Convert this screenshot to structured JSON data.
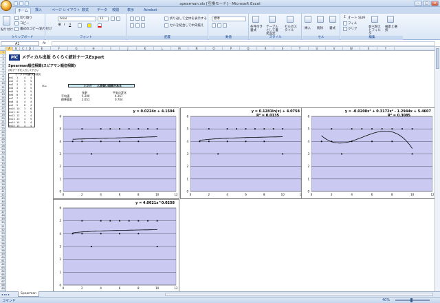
{
  "window": {
    "title": "spearman.xls  [互換モード] - Microsoft Excel"
  },
  "tabs": [
    "ホーム",
    "挿入",
    "ページ レイアウト",
    "数式",
    "データ",
    "校閲",
    "表示",
    "Acrobat"
  ],
  "ribbon": {
    "clipboard": {
      "paste": "貼り付け",
      "cut": "切り取り",
      "copy": "コピー",
      "format_painter": "書式のコピー/貼り付け",
      "label": "クリップボード"
    },
    "font": {
      "name": "Arial",
      "size": "11",
      "label": "フォント"
    },
    "alignment": {
      "wrap": "折り返して全体を表示する",
      "merge": "セルを結合して中央揃え",
      "label": "配置"
    },
    "number": {
      "format": "標準",
      "label": "数値"
    },
    "styles": {
      "conditional": "条件付き書式",
      "table": "テーブルとして書式設定",
      "cell_styles": "セルのスタイル",
      "label": "スタイル"
    },
    "cells": {
      "insert": "挿入",
      "delete": "削除",
      "format": "書式",
      "label": "セル"
    },
    "editing": {
      "autosum": "オート SUM",
      "fill": "フィル",
      "clear": "クリア",
      "sort": "並べ替えとフィルタ",
      "find": "検索と選択",
      "label": "編集"
    }
  },
  "formula_bar": {
    "name_box": "A1",
    "fx": "fx",
    "value": ""
  },
  "columns": [
    "A",
    "B",
    "C",
    "D",
    "E",
    "F",
    "G",
    "H",
    "I",
    "J",
    "K",
    "L",
    "M",
    "N",
    "O",
    "P",
    "Q",
    "R",
    "S",
    "T",
    "U",
    "V",
    "W",
    "X",
    "Y"
  ],
  "rows_visible": 69,
  "sheet": {
    "logo_text": "MC",
    "publisher_title": "メディカル出版  らくらく統計ナースExpert",
    "heading": "Spearman順位相関(スピアマン順位相関)",
    "note": "(例)データを入力して下さい",
    "col_headers": [
      "データ",
      "平均値",
      "不安の変化"
    ],
    "labels": [
      "ex1",
      "ex2",
      "ex3",
      "ex4",
      "ex5",
      "ex6",
      "ex7",
      "ex8",
      "ex9",
      "ex10",
      "ex11",
      "ex12",
      "ex13",
      "ex14",
      "ex15"
    ],
    "col_b": [
      "1",
      "2",
      "3",
      "4",
      "5",
      "6",
      "7",
      "8",
      "9",
      "10",
      "11",
      "12",
      "13",
      "14",
      "15"
    ],
    "col_c": [
      "4",
      "5",
      "3",
      "4",
      "6",
      "5",
      "4",
      "4",
      "6",
      "3",
      "5",
      "4",
      "4",
      "5",
      "4"
    ],
    "col_d": [
      "4",
      "5",
      "5",
      "5",
      "5",
      "4",
      "5",
      "4",
      "4",
      "6",
      "5",
      "4",
      "5",
      "4",
      "4"
    ],
    "rs_label": "rs=",
    "rs_value": "0.009",
    "rs_result": "人変弱い相関がある",
    "stat_headers": [
      "年齢",
      "不安の変化"
    ],
    "stat_rows": [
      {
        "label": "平均値",
        "v1": "5.200",
        "v2": "4.267"
      },
      {
        "label": "標準偏差",
        "v1": "2.651",
        "v2": "0.704"
      }
    ]
  },
  "chart_data": [
    {
      "type": "scatter",
      "equation": "y = 0.0224x + 4.1504",
      "r2": "",
      "fit": "linear",
      "coef": [
        4.1504,
        0.0224
      ],
      "xlim": [
        0,
        12
      ],
      "ylim": [
        0,
        6
      ],
      "xticks": [
        "0",
        "2",
        "4",
        "6",
        "8",
        "10",
        "12"
      ],
      "yticks": [
        "0",
        "1",
        "2",
        "3",
        "4",
        "5",
        "6"
      ],
      "points": [
        [
          1,
          4
        ],
        [
          2,
          5
        ],
        [
          3,
          3
        ],
        [
          4,
          4
        ],
        [
          5,
          5
        ],
        [
          6,
          4
        ],
        [
          7,
          5
        ],
        [
          8,
          4
        ],
        [
          9,
          5
        ],
        [
          10,
          3
        ],
        [
          2,
          4
        ],
        [
          4,
          5
        ],
        [
          6,
          5
        ],
        [
          8,
          5
        ],
        [
          10,
          5
        ]
      ]
    },
    {
      "type": "scatter",
      "equation": "y = 0.1281ln(x) + 4.0758",
      "r2": "R² = 0.0135",
      "fit": "log",
      "coef": [
        4.0758,
        0.1281
      ],
      "xlim": [
        0,
        12
      ],
      "ylim": [
        0,
        6
      ],
      "xticks": [
        "0",
        "2",
        "4",
        "6",
        "8",
        "10",
        "12"
      ],
      "yticks": [
        "0",
        "1",
        "2",
        "3",
        "4",
        "5",
        "6"
      ],
      "points": [
        [
          1,
          4
        ],
        [
          2,
          5
        ],
        [
          3,
          3
        ],
        [
          4,
          4
        ],
        [
          5,
          5
        ],
        [
          6,
          4
        ],
        [
          7,
          5
        ],
        [
          8,
          4
        ],
        [
          9,
          5
        ],
        [
          10,
          3
        ],
        [
          2,
          4
        ],
        [
          4,
          5
        ],
        [
          6,
          5
        ],
        [
          8,
          5
        ],
        [
          10,
          5
        ]
      ]
    },
    {
      "type": "scatter",
      "equation": "y = -0.0208x³ + 0.3172x² - 1.2944x + 5.4607",
      "r2": "R² = 0.3085",
      "fit": "poly",
      "coef": [
        5.4607,
        -1.2944,
        0.3172,
        -0.0208
      ],
      "xlim": [
        0,
        12
      ],
      "ylim": [
        0,
        6
      ],
      "xticks": [
        "0",
        "2",
        "4",
        "6",
        "8",
        "10",
        "12"
      ],
      "yticks": [
        "0",
        "1",
        "2",
        "3",
        "4",
        "5",
        "6"
      ],
      "points": [
        [
          1,
          4
        ],
        [
          2,
          5
        ],
        [
          3,
          3
        ],
        [
          4,
          4
        ],
        [
          5,
          5
        ],
        [
          6,
          4
        ],
        [
          7,
          5
        ],
        [
          8,
          4
        ],
        [
          9,
          5
        ],
        [
          10,
          3
        ],
        [
          2,
          4
        ],
        [
          4,
          5
        ],
        [
          6,
          5
        ],
        [
          8,
          5
        ],
        [
          10,
          5
        ]
      ]
    },
    {
      "type": "scatter",
      "equation": "y = 4.0621x^0.0258",
      "r2": "",
      "fit": "power",
      "coef": [
        4.0621,
        0.0258
      ],
      "xlim": [
        0,
        12
      ],
      "ylim": [
        0,
        6
      ],
      "xticks": [
        "0",
        "2",
        "4",
        "6",
        "8",
        "10",
        "12"
      ],
      "yticks": [
        "0",
        "1",
        "2",
        "3",
        "4",
        "5",
        "6"
      ],
      "points": [
        [
          1,
          4
        ],
        [
          2,
          5
        ],
        [
          3,
          3
        ],
        [
          4,
          4
        ],
        [
          5,
          5
        ],
        [
          6,
          4
        ],
        [
          7,
          5
        ],
        [
          8,
          4
        ],
        [
          9,
          5
        ],
        [
          10,
          3
        ],
        [
          2,
          4
        ],
        [
          4,
          5
        ],
        [
          6,
          5
        ],
        [
          8,
          5
        ],
        [
          10,
          5
        ]
      ]
    }
  ],
  "sheet_tabs": [
    "Spearman"
  ],
  "status": {
    "mode": "コマンド",
    "zoom": "40%"
  }
}
